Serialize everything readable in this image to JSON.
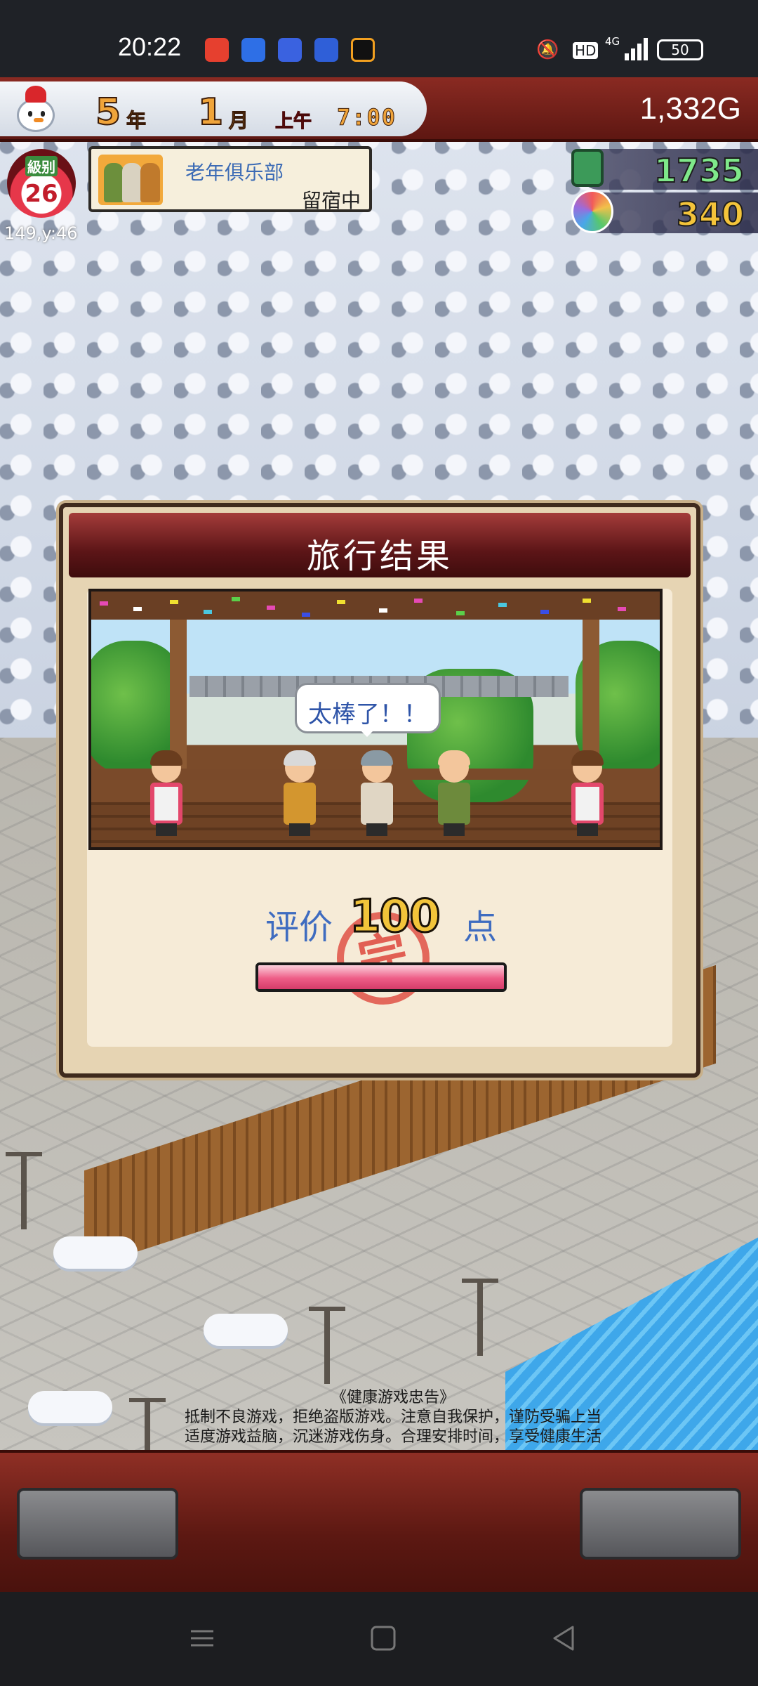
{
  "status_bar": {
    "time": "20:22",
    "battery": "50",
    "network": "4G",
    "hd_label": "HD",
    "notification_icons": [
      "video-app-icon",
      "infinity-app-icon",
      "paw-app-icon",
      "blue-dot-app-icon",
      "orange-square-app-icon"
    ]
  },
  "hud": {
    "year_num": "5",
    "year_unit": "年",
    "month_num": "1",
    "month_unit": "月",
    "period": "上午",
    "clock": "7:00",
    "money": "1,332G",
    "level_label": "級别",
    "level": "26",
    "coords": "149,y:46",
    "group_name": "老年俱乐部",
    "group_status": "留宿中",
    "tickets": "1735",
    "spa_points": "340",
    "ticket_color": "#7fe88a",
    "spa_color": "#f4c43a"
  },
  "dialog": {
    "title": "旅行结果",
    "speech": "太棒了！！",
    "rating_label": "评价",
    "rating_value": "100",
    "rating_unit": "点",
    "rating_stamp": "完",
    "rating_fraction": 1.0
  },
  "health_notice": {
    "title": "《健康游戏忠告》",
    "line1": "抵制不良游戏，拒绝盗版游戏。注意自我保护，谨防受骗上当",
    "line2": "适度游戏益脑，沉迷游戏伤身。合理安排时间，享受健康生活"
  },
  "colors": {
    "hud_red": "#8a2a22",
    "dialog_header": "#5c1517",
    "rating_blue": "#3f6cc0",
    "bar_pink": "#ee5d87"
  }
}
